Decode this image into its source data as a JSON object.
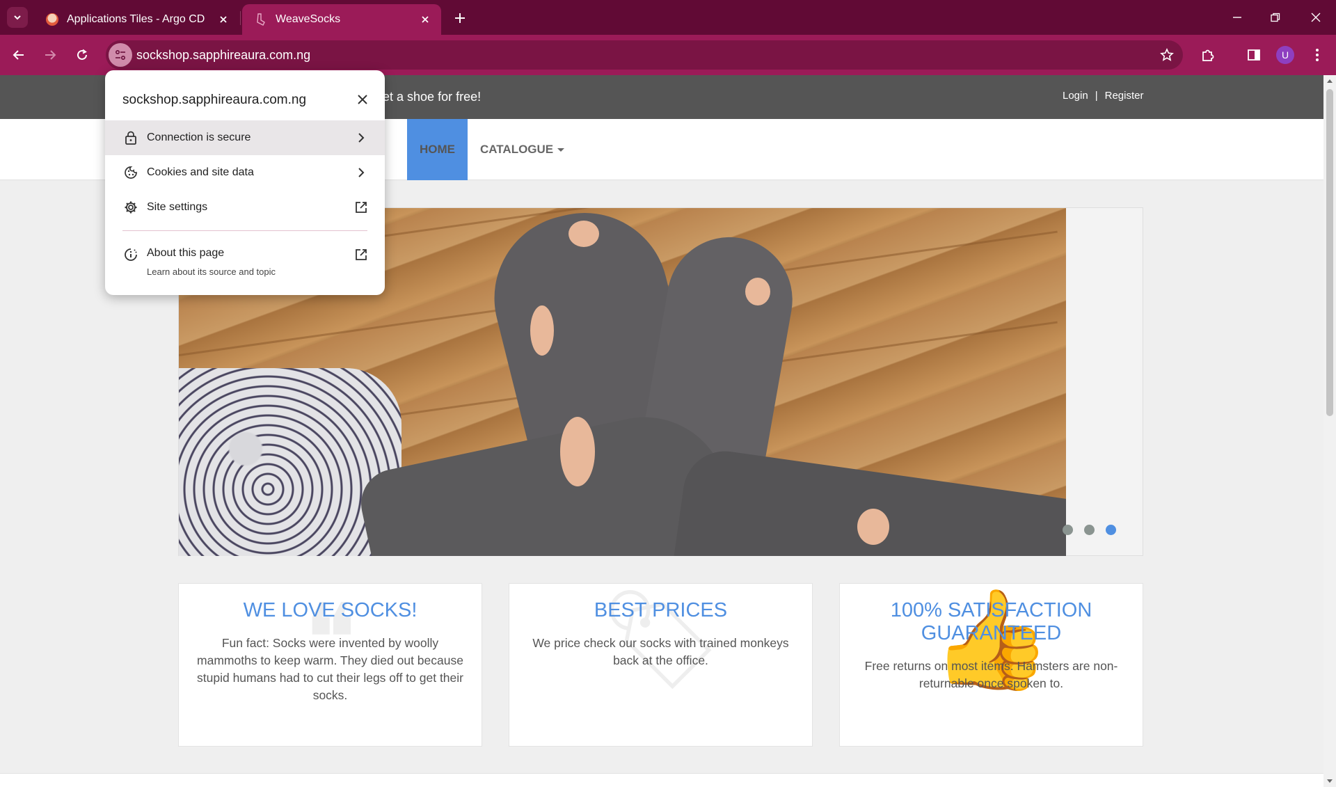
{
  "browser": {
    "tabs": [
      {
        "title": "Applications Tiles - Argo CD",
        "active": false
      },
      {
        "title": "WeaveSocks",
        "active": true
      }
    ],
    "url": "sockshop.sapphireaura.com.ng",
    "profile_initial": "U"
  },
  "site_popup": {
    "host": "sockshop.sapphireaura.com.ng",
    "items": [
      {
        "label": "Connection is secure",
        "icon": "lock-icon",
        "end_icon": "chevron-right-icon"
      },
      {
        "label": "Cookies and site data",
        "icon": "cookie-icon",
        "end_icon": "chevron-right-icon"
      },
      {
        "label": "Site settings",
        "icon": "gear-icon",
        "end_icon": "external-link-icon"
      }
    ],
    "about": {
      "label": "About this page",
      "sub": "Learn about its source and topic"
    }
  },
  "page": {
    "offer_text": "get a shoe for free!",
    "auth": {
      "login": "Login",
      "separator": "|",
      "register": "Register"
    },
    "nav": {
      "home": "HOME",
      "catalogue": "CATALOGUE"
    },
    "carousel": {
      "slide_count": 3,
      "active_slide": 3
    },
    "features": [
      {
        "title": "WE LOVE SOCKS!",
        "text": "Fun fact: Socks were invented by woolly mammoths to keep warm. They died out because stupid humans had to cut their legs off to get their socks."
      },
      {
        "title": "BEST PRICES",
        "text": "We price check our socks with trained monkeys back at the office."
      },
      {
        "title": "100% SATISFACTION GUARANTEED",
        "text": "Free returns on most items. Hamsters are non-returnable once spoken to."
      }
    ]
  },
  "colors": {
    "tabbar": "#610a35",
    "toolbar": "#9b1b58",
    "accent_blue": "#4f8fe1",
    "topbar": "#555555"
  }
}
